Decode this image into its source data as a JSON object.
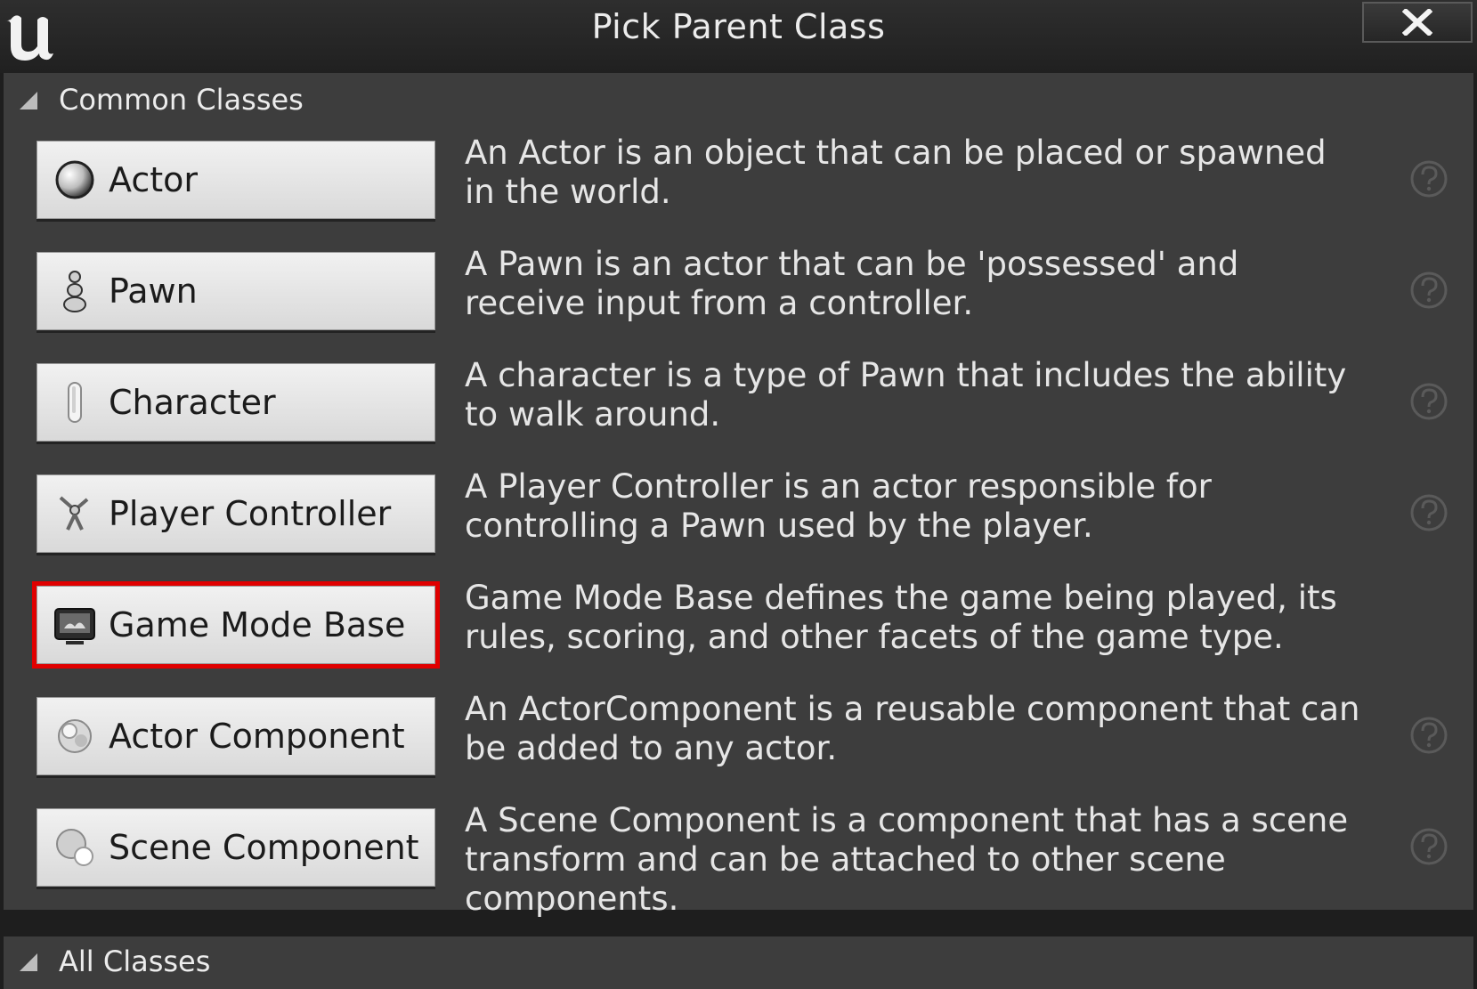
{
  "window": {
    "title": "Pick Parent Class",
    "logo_icon": "unreal-logo-icon",
    "close_icon": "close-icon"
  },
  "common_classes": {
    "label": "Common Classes",
    "items": [
      {
        "label": "Actor",
        "icon": "actor-sphere-icon",
        "description": "An Actor is an object that can be placed or spawned in the world.",
        "selected": false
      },
      {
        "label": "Pawn",
        "icon": "pawn-icon",
        "description": "A Pawn is an actor that can be 'possessed' and receive input from a controller.",
        "selected": false
      },
      {
        "label": "Character",
        "icon": "character-icon",
        "description": "A character is a type of Pawn that includes the ability to walk around.",
        "selected": false
      },
      {
        "label": "Player Controller",
        "icon": "player-controller-icon",
        "description": "A Player Controller is an actor responsible for controlling a Pawn used by the player.",
        "selected": false
      },
      {
        "label": "Game Mode Base",
        "icon": "game-mode-icon",
        "description": "Game Mode Base defines the game being played, its rules, scoring, and other facets of the game type.",
        "selected": true
      },
      {
        "label": "Actor Component",
        "icon": "actor-component-icon",
        "description": "An ActorComponent is a reusable component that can be added to any actor.",
        "selected": false
      },
      {
        "label": "Scene Component",
        "icon": "scene-component-icon",
        "description": "A Scene Component is a component that has a scene transform and can be attached to other scene components.",
        "selected": false
      }
    ]
  },
  "all_classes": {
    "label": "All Classes"
  },
  "colors": {
    "highlight": "#e00000",
    "panel": "#3d3d3d",
    "button": "#e3e3e3"
  }
}
